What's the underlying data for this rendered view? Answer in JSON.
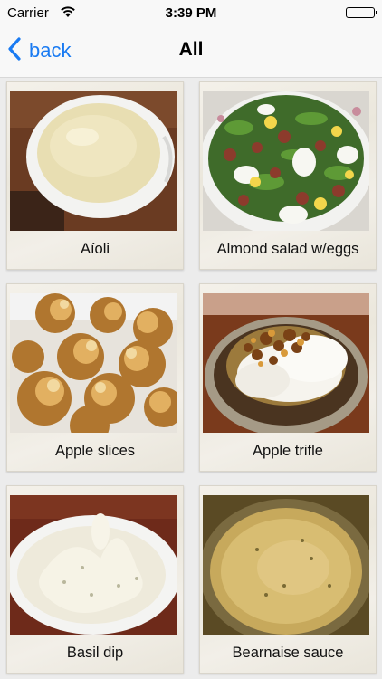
{
  "status_bar": {
    "carrier": "Carrier",
    "time": "3:39 PM",
    "wifi_icon": "wifi-icon",
    "battery_icon": "battery-icon"
  },
  "nav": {
    "back_label": "back",
    "back_icon": "chevron-left-icon",
    "title": "All",
    "accent_color": "#1a7bf2"
  },
  "recipes": [
    {
      "name": "Aíoli"
    },
    {
      "name": "Almond salad w/eggs"
    },
    {
      "name": "Apple slices"
    },
    {
      "name": "Apple trifle"
    },
    {
      "name": "Basil dip"
    },
    {
      "name": "Bearnaise sauce"
    }
  ]
}
